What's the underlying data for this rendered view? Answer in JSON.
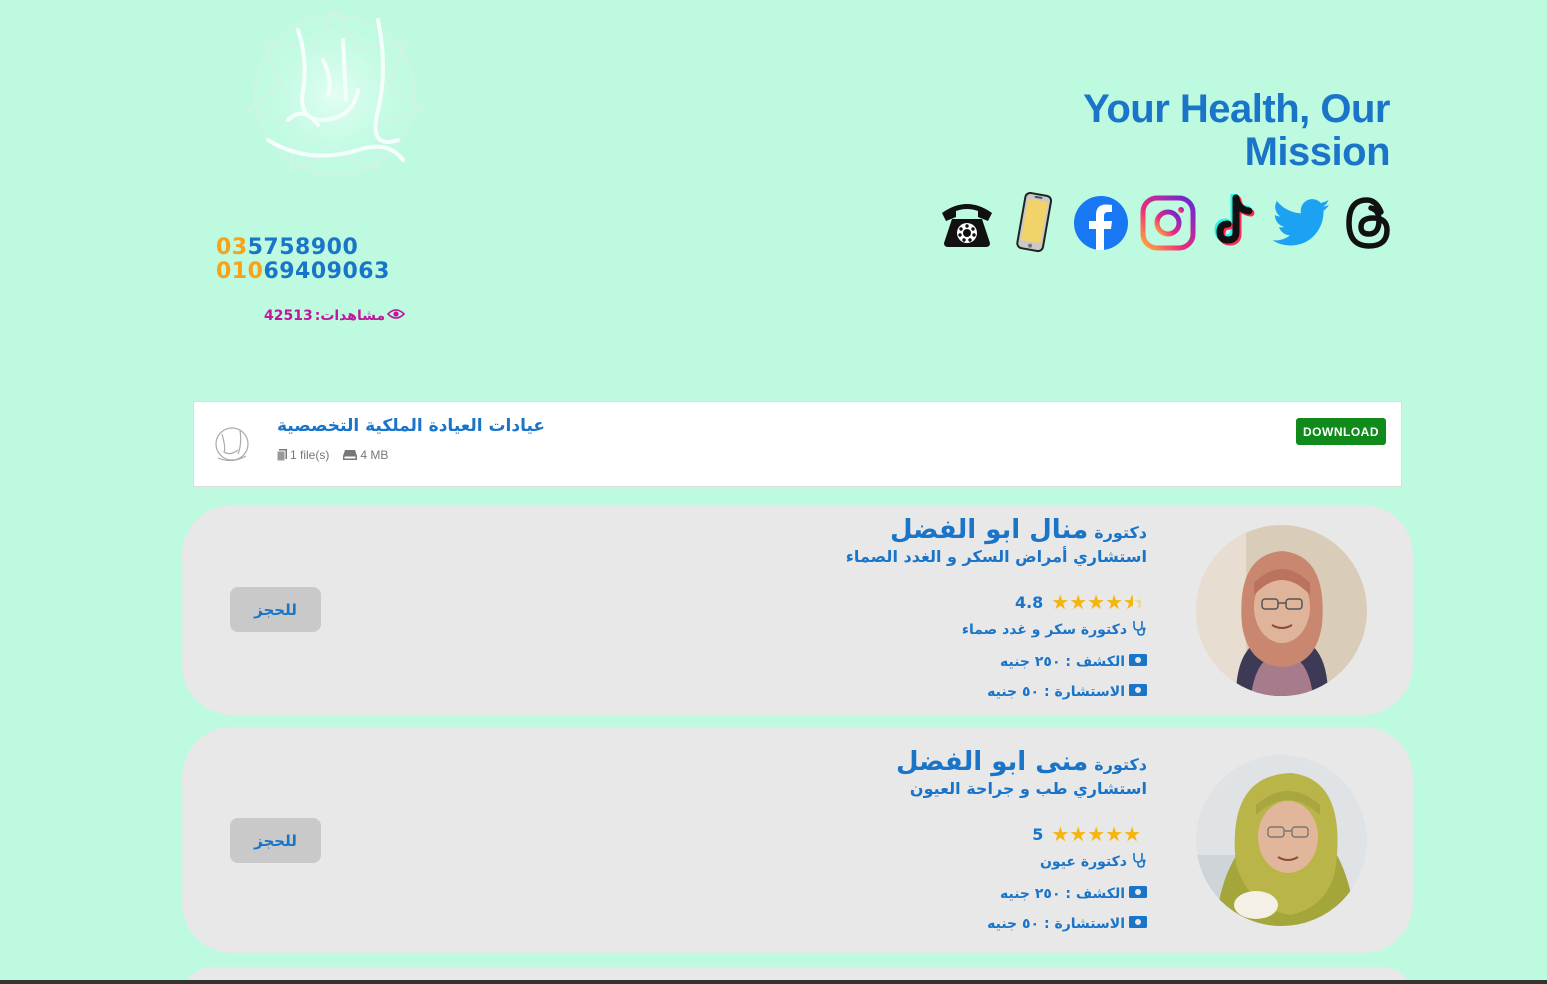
{
  "logo": {
    "text": "العيادة الملكية"
  },
  "phones": [
    {
      "prefix": "03",
      "number": "5758900"
    },
    {
      "prefix": "010",
      "number": "69409063"
    }
  ],
  "views": {
    "label": "مشاهدات:",
    "count": "42513",
    "icon": "eye-icon"
  },
  "tagline": "Your Health, Our Mission",
  "socials": [
    {
      "name": "telephone-icon"
    },
    {
      "name": "mobile-icon"
    },
    {
      "name": "facebook-icon",
      "color": "#1877f2"
    },
    {
      "name": "instagram-icon"
    },
    {
      "name": "tiktok-icon"
    },
    {
      "name": "twitter-icon",
      "color": "#1da1f2"
    },
    {
      "name": "threads-icon"
    }
  ],
  "download": {
    "title": "عيادات العيادة الملكية التخصصية",
    "files": "1 file(s)",
    "size": "4 MB",
    "button": "DOWNLOAD",
    "button_color": "#108a1a"
  },
  "doctors": [
    {
      "prefix": "دكتورة",
      "name": "منال ابو الفضل",
      "specialty": "استشاري أمراض السكر و الغدد الصماء",
      "rating": "4.8",
      "rating_value": 4.5,
      "title": "دكتورة سكر و غدد صماء",
      "exam_fee": "الكشف : ٢٥٠ جنيه",
      "consult_fee": "الاستشارة : ٥٠ جنيه",
      "book": "للحجز"
    },
    {
      "prefix": "دكتورة",
      "name": "منى ابو الفضل",
      "specialty": "استشاري طب و جراحة العيون",
      "rating": "5",
      "rating_value": 5,
      "title": "دكتورة عيون",
      "exam_fee": "الكشف : ٢٥٠ جنيه",
      "consult_fee": "الاستشارة : ٥٠ جنيه",
      "book": "للحجز"
    }
  ]
}
